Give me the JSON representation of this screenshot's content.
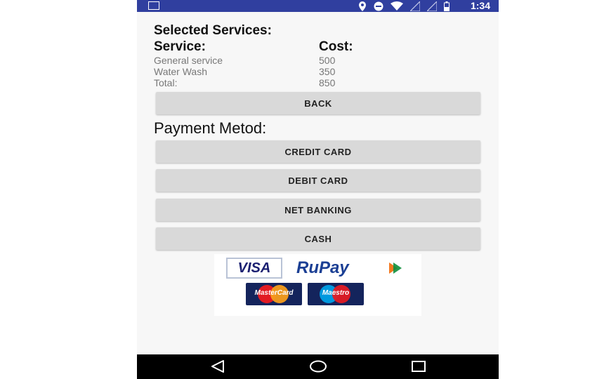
{
  "status_bar": {
    "time": "1:34",
    "icons": [
      "image-icon",
      "location-icon",
      "do-not-disturb-icon",
      "wifi-icon",
      "signal-icon",
      "signal-icon",
      "battery-icon"
    ]
  },
  "summary": {
    "heading": "Selected Services:",
    "col_service": "Service:",
    "col_cost": "Cost:",
    "rows": [
      {
        "service": "General service",
        "cost": "500"
      },
      {
        "service": "Water Wash",
        "cost": "350"
      },
      {
        "service": "Total:",
        "cost": "850"
      }
    ]
  },
  "buttons": {
    "back": "BACK",
    "credit": "CREDIT CARD",
    "debit": "DEBIT CARD",
    "netbanking": "NET BANKING",
    "cash": "CASH"
  },
  "payment_title": "Payment Metod:",
  "logos": {
    "visa": "VISA",
    "rupay": "RuPay",
    "mastercard": "MasterCard",
    "maestro": "Maestro"
  },
  "colors": {
    "status_bar": "#303f9f",
    "button_bg": "#d9d9d9",
    "nav_bar": "#000000"
  },
  "nav_bar": {
    "icons": [
      "back-icon",
      "home-icon",
      "recents-icon"
    ]
  }
}
